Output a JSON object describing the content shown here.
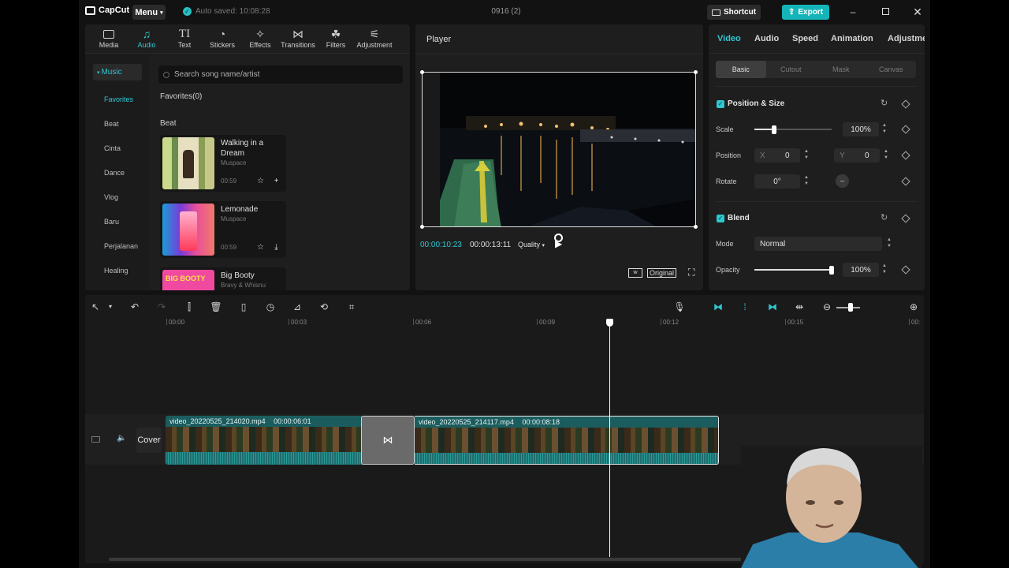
{
  "app": {
    "logo": "CapCut",
    "menu_label": "Menu",
    "autosave": "Auto saved: 10:08:28",
    "project_title": "0916 (2)",
    "shortcut_label": "Shortcut",
    "export_label": "Export"
  },
  "tool_tabs": [
    "Media",
    "Audio",
    "Text",
    "Stickers",
    "Effects",
    "Transitions",
    "Filters",
    "Adjustment"
  ],
  "music": {
    "category_header": "Music",
    "categories": [
      "Favorites",
      "Beat",
      "Cinta",
      "Dance",
      "Vlog",
      "Baru",
      "Perjalanan",
      "Healing"
    ],
    "search_placeholder": "Search song name/artist",
    "favorites_label": "Favorites(0)",
    "beat_label": "Beat",
    "songs": [
      {
        "title": "Walking in a Dream",
        "artist": "Muspace",
        "duration": "00:59"
      },
      {
        "title": "Lemonade",
        "artist": "Muspace",
        "duration": "00:59"
      },
      {
        "title": "Big Booty",
        "artist": "Bravy & Whisnu",
        "duration": ""
      }
    ],
    "thumb3_text": "BIG BOOTY"
  },
  "player": {
    "title": "Player",
    "current_time": "00:00:10:23",
    "total_time": "00:00:13:11",
    "quality_label": "Quality",
    "original_label": "Original"
  },
  "props": {
    "tabs": [
      "Video",
      "Audio",
      "Speed",
      "Animation",
      "Adjustme"
    ],
    "subtabs": [
      "Basic",
      "Cutout",
      "Mask",
      "Canvas"
    ],
    "position_size": "Position & Size",
    "scale_label": "Scale",
    "scale_value": "100%",
    "scale_level": 0.25,
    "position_label": "Position",
    "x_label": "X",
    "x_value": "0",
    "y_label": "Y",
    "y_value": "0",
    "rotate_label": "Rotate",
    "rotate_value": "0°",
    "rotate_knob": "–",
    "blend": "Blend",
    "mode_label": "Mode",
    "mode_value": "Normal",
    "opacity_label": "Opacity",
    "opacity_value": "100%",
    "opacity_level": 1.0
  },
  "timeline": {
    "ruler": [
      "00:00",
      "00:03",
      "00:06",
      "00:09",
      "00:12",
      "00:15",
      "00:"
    ],
    "cover_label": "Cover",
    "clips": [
      {
        "name": "video_20220525_214020.mp4",
        "duration": "00:00:06:01"
      },
      {
        "name": "video_20220525_214117.mp4",
        "duration": "00:00:08:18"
      }
    ],
    "transition_icon": "⋈"
  }
}
